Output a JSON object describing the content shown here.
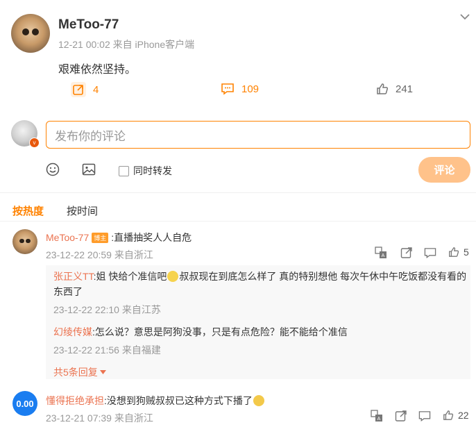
{
  "post": {
    "username": "MeToo-77",
    "meta": "12-21 00:02 来自 iPhone客户端",
    "text": "艰难依然坚持。",
    "reposts": "4",
    "comments": "109",
    "likes": "241"
  },
  "composer": {
    "placeholder": "发布你的评论",
    "repost_label": "同时转发",
    "submit_label": "评论"
  },
  "tabs": {
    "hot": "按热度",
    "time": "按时间"
  },
  "comments": [
    {
      "username": "MeToo-77",
      "badge": "博主",
      "text": ":直播抽奖人人自危",
      "meta": "23-12-22 20:59 来自浙江",
      "likes": "5",
      "replies": [
        {
          "username": "张正义TT",
          "text_a": ":姐 快给个准信吧",
          "text_b": "叔叔现在到底怎么样了 真的特别想他 每次午休中午吃饭都没有看的东西了",
          "meta": "23-12-22 22:10 来自江苏"
        },
        {
          "username": "幻绫传媒",
          "text": ":怎么说？意思是阿狗没事，只是有点危险？能不能给个准信",
          "meta": "23-12-22 21:56 来自福建"
        }
      ],
      "more_replies": "共5条回复"
    },
    {
      "username": "懂得拒绝承担",
      "avatar_text": "0.00",
      "text": ":没想到狗贼叔叔已这种方式下播了",
      "meta": "23-12-21 07:39 来自浙江",
      "likes": "22"
    }
  ]
}
